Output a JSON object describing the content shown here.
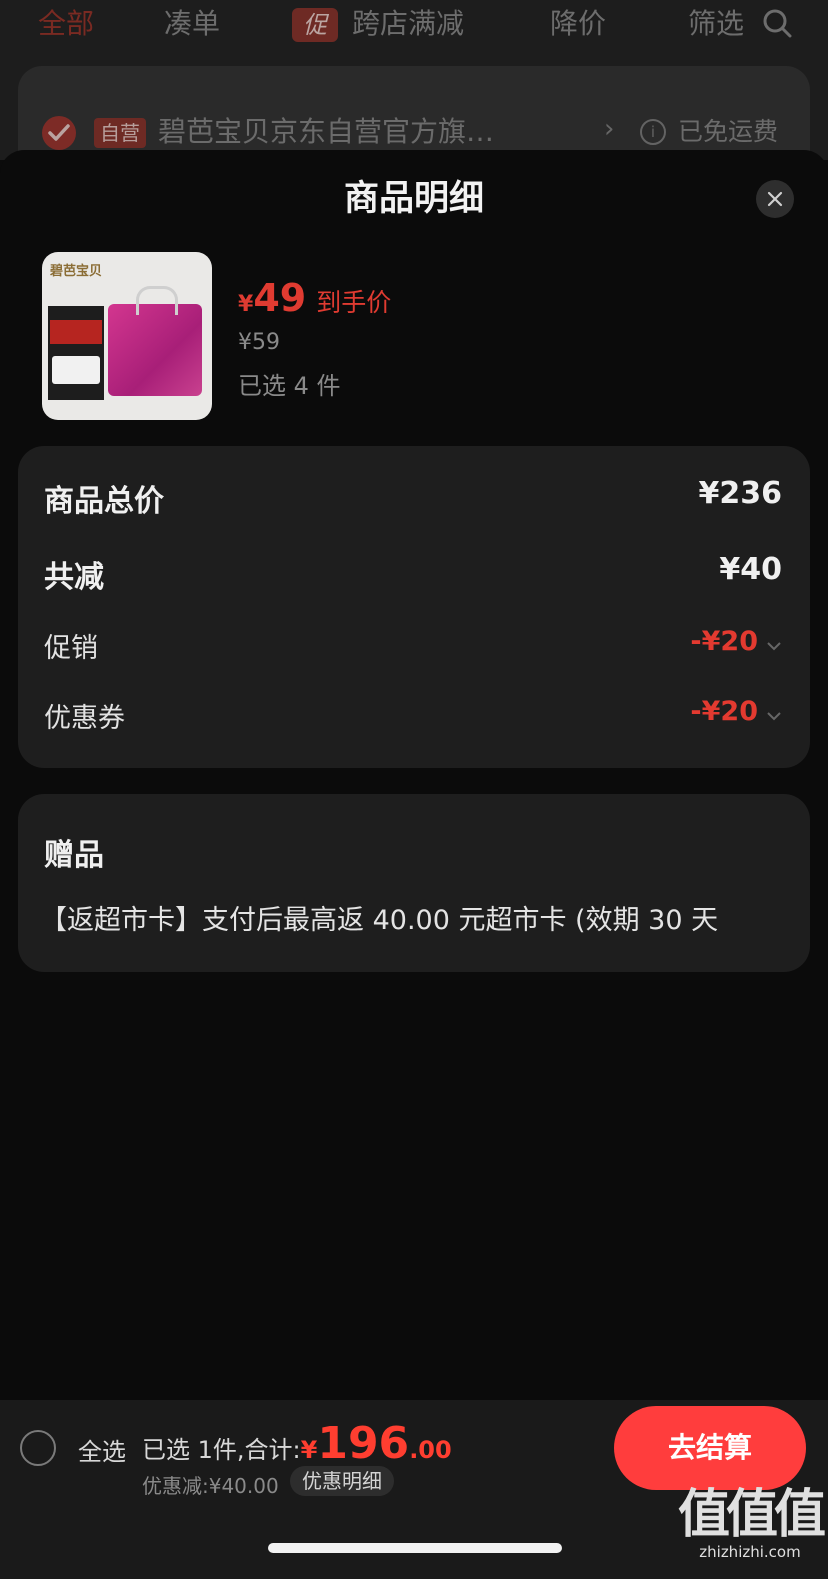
{
  "bg_tabs": {
    "all": "全部",
    "bundle": "凑单",
    "promo_badge": "促",
    "cross_store": "跨店满减",
    "price_drop": "降价",
    "filter": "筛选"
  },
  "bg_store": {
    "self_run": "自营",
    "name": "碧芭宝贝京东自营官方旗…",
    "arrow": "›",
    "info_icon": "i",
    "shipping": "已免运费"
  },
  "sheet": {
    "title": "商品明细"
  },
  "product": {
    "thumb_logo": "碧芭宝贝",
    "currency": "¥",
    "price": "49",
    "price_tag": "到手价",
    "original_price": "¥59",
    "selected": "已选 4 件"
  },
  "summary": {
    "total_label": "商品总价",
    "total_value": "¥236",
    "reduce_label": "共减",
    "reduce_value": "¥40",
    "promo_label": "促销",
    "promo_value": "-¥20",
    "coupon_label": "优惠券",
    "coupon_value": "-¥20"
  },
  "gift": {
    "title": "赠品",
    "text": "【返超市卡】支付后最高返 40.00 元超市卡 (效期 30 天"
  },
  "bottom": {
    "select_all": "全选",
    "total_prefix": "已选 1件,合计:",
    "currency": "¥",
    "total_int": "196",
    "total_dec": ".00",
    "discount": "优惠减:¥40.00",
    "detail_chip": "优惠明细",
    "checkout": "去结算"
  },
  "watermark": {
    "big": "值值值",
    "small": "zhizhizhi.com"
  },
  "colors": {
    "accent_red": "#e03b31",
    "checkout_red": "#ff3d3d",
    "card_bg": "#1e1e1e"
  }
}
